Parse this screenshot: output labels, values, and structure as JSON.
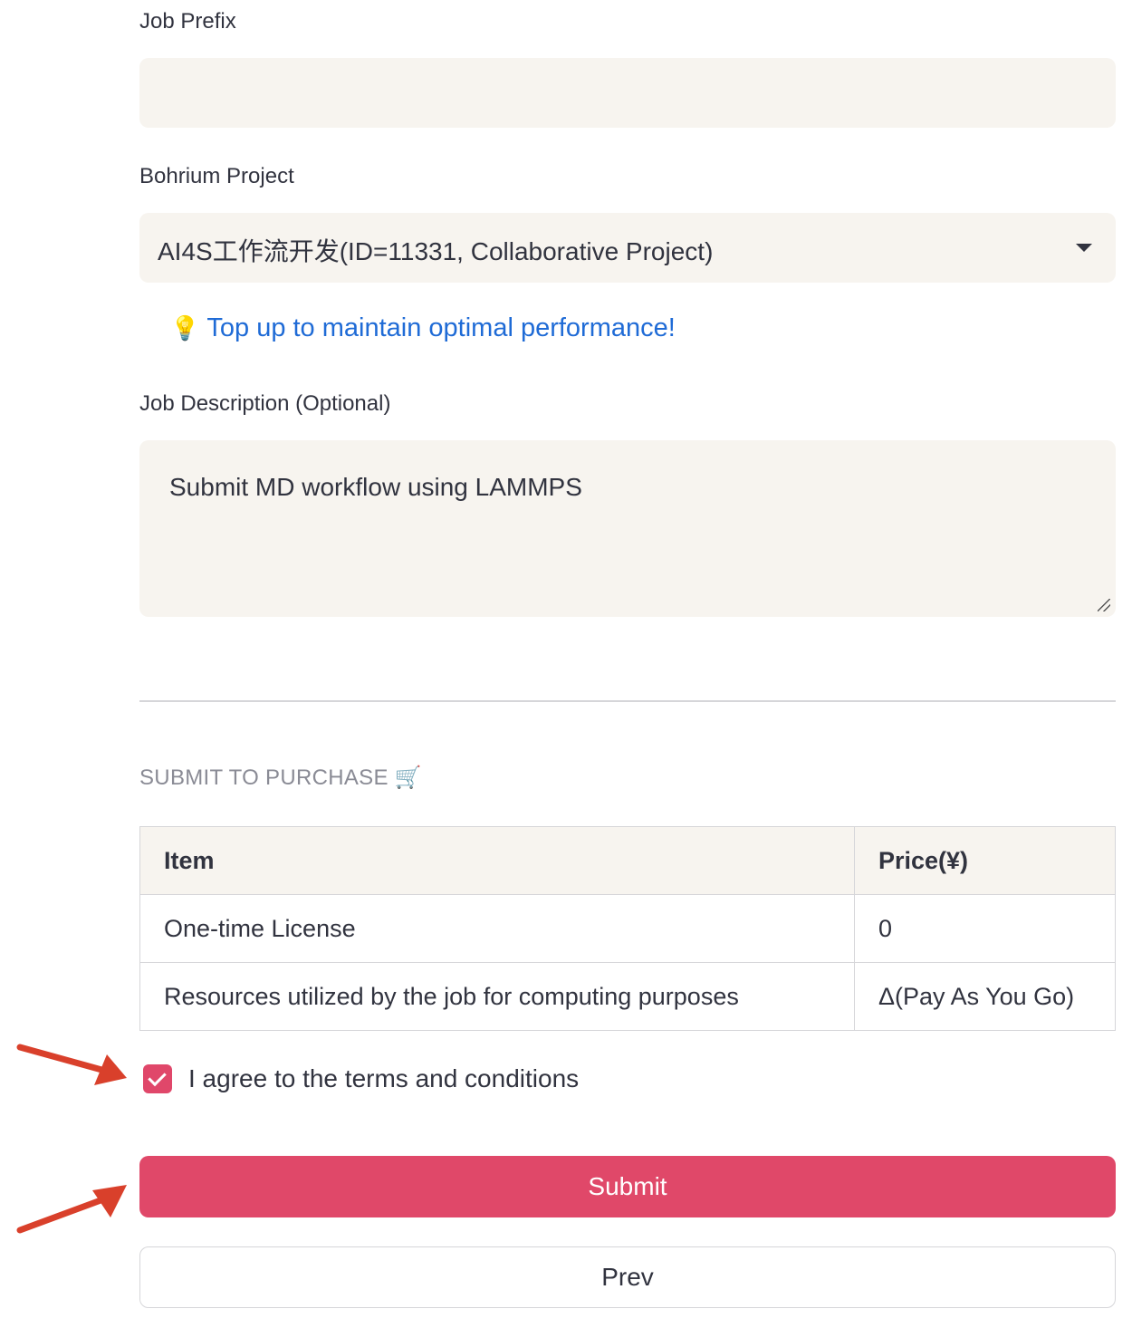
{
  "form": {
    "job_prefix_label": "Job Prefix",
    "job_prefix_value": "",
    "project_label": "Bohrium Project",
    "project_selected": "AI4S工作流开发(ID=11331, Collaborative Project)",
    "topup_link": "Top up to maintain optimal performance!",
    "description_label": "Job Description (Optional)",
    "description_value": "Submit MD workflow using LAMMPS"
  },
  "purchase": {
    "heading": "SUBMIT TO PURCHASE 🛒",
    "columns": [
      "Item",
      "Price(¥)"
    ],
    "rows": [
      [
        "One-time License",
        "0"
      ],
      [
        "Resources utilized by the job for computing purposes",
        "Δ(Pay As You Go)"
      ]
    ]
  },
  "agree": {
    "label": "I agree to the terms and conditions",
    "checked": true
  },
  "buttons": {
    "submit": "Submit",
    "prev": "Prev"
  },
  "colors": {
    "accent": "#e04869",
    "link": "#1f6bd6",
    "field_bg": "#f7f4ef",
    "annotation_arrow": "#d9402b"
  }
}
